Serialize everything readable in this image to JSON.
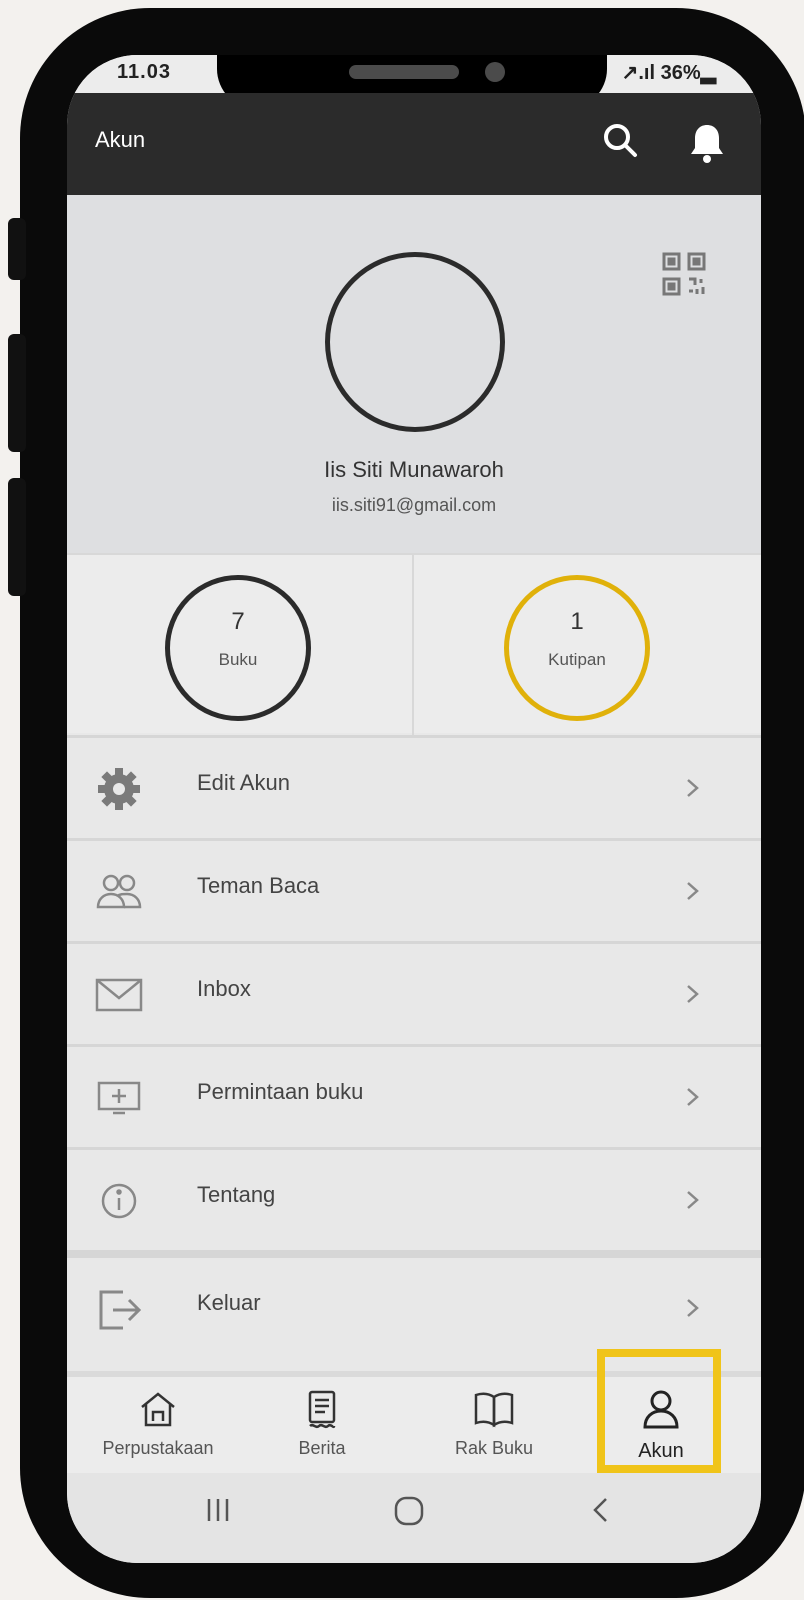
{
  "status_bar": {
    "time": "11.03",
    "indicators": "↗.ıl 36%▂"
  },
  "app_bar": {
    "title": "Akun",
    "icons": [
      "search-icon",
      "bell-icon"
    ]
  },
  "profile": {
    "name": "Iis Siti Munawaroh",
    "email": "iis.siti91@gmail.com",
    "qr_icon": "qr-code-icon"
  },
  "stats": [
    {
      "value": "7",
      "label": "Buku",
      "color": "#2b2b2b"
    },
    {
      "value": "1",
      "label": "Kutipan",
      "color": "#e0b10a"
    }
  ],
  "menu": [
    {
      "label": "Edit Akun",
      "icon": "gear-icon"
    },
    {
      "label": "Teman Baca",
      "icon": "people-icon"
    },
    {
      "label": "Inbox",
      "icon": "mail-icon"
    },
    {
      "label": "Permintaan buku",
      "icon": "monitor-plus-icon"
    },
    {
      "label": "Tentang",
      "icon": "info-icon"
    },
    {
      "label": "Keluar",
      "icon": "logout-icon"
    }
  ],
  "bottom_nav": [
    {
      "label": "Perpustakaan",
      "icon": "home-icon"
    },
    {
      "label": "Berita",
      "icon": "news-icon"
    },
    {
      "label": "Rak Buku",
      "icon": "book-icon"
    },
    {
      "label": "Akun",
      "icon": "user-icon",
      "active": true
    }
  ],
  "highlight_color": "#f0c419"
}
